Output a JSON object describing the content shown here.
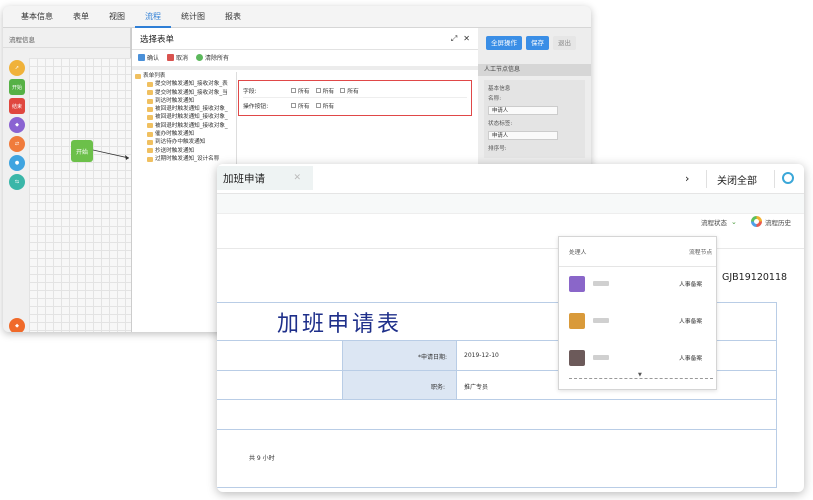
{
  "back": {
    "tabs": [
      "基本信息",
      "表单",
      "视图",
      "流程",
      "统计图",
      "报表"
    ],
    "active_tab": "流程",
    "left_panel_title": "流程信息",
    "palette": [
      {
        "name": "arrow-icon",
        "color": "#f0b23a",
        "label": ""
      },
      {
        "name": "start-icon",
        "color": "#56b146",
        "label": "开始"
      },
      {
        "name": "end-icon",
        "color": "#e0473e",
        "label": "结束"
      },
      {
        "name": "gateway-icon",
        "color": "#8a63d2",
        "label": ""
      },
      {
        "name": "task-icon",
        "color": "#f07b3c",
        "label": ""
      },
      {
        "name": "user-icon",
        "color": "#3fa4e0",
        "label": ""
      },
      {
        "name": "branch-icon",
        "color": "#3ab6a8",
        "label": ""
      },
      {
        "name": "eraser-icon",
        "color": "#f06a2a",
        "label": ""
      }
    ],
    "start_node_label": "开始",
    "dialog": {
      "title": "选择表单",
      "ctrl_expand": "⤢",
      "ctrl_close": "✕",
      "tools": [
        "确认",
        "取消",
        "清除所有"
      ],
      "tree_root": "表单列表",
      "tree_items": [
        "提交时触发通知_接收对象_表",
        "提交时触发通知_接收对象_当",
        "到达时触发通知",
        "被回退时触发通知_接收对象_",
        "被回退时触发通知_接收对象_",
        "被回退时触发通知_接收对象_",
        "催办时触发通知",
        "到达待办中触发通知",
        "抄送时触发通知",
        "过期时触发通知_设计名称"
      ],
      "field_rows": [
        {
          "label": "字段:",
          "options": [
            "所有",
            "所有",
            "所有"
          ]
        },
        {
          "label": "操作按钮:",
          "options": [
            "所有",
            "所有"
          ]
        }
      ]
    },
    "right_panel": {
      "buttons": [
        "全屏操作",
        "保存",
        "退出"
      ],
      "section_title": "人工节点信息",
      "box_title": "基本信息",
      "name_label": "名称:",
      "name_value": "申请人",
      "state_label": "状态标签:",
      "state_value": "申请人",
      "order_label": "排序号:"
    }
  },
  "front": {
    "tab_title": "加班申请",
    "tab_close": "✕",
    "nav_arrow": "›",
    "close_all": "关闭全部",
    "flow_status": "流程状态",
    "flow_history": "流程历史",
    "form_title": "加班申请表",
    "doc_no": "GJB19120118",
    "fields": [
      {
        "label": "*申请日期:",
        "value": "2019-12-10"
      },
      {
        "label": "职务:",
        "value": "推广专员"
      }
    ],
    "footer_text": "共  9  小时",
    "history": {
      "col_handler": "处理人",
      "col_node": "流程节点",
      "rows": [
        {
          "node": "人事备案",
          "avatar_color": "#8a66c9"
        },
        {
          "node": "人事备案",
          "avatar_color": "#d99a3a"
        },
        {
          "node": "人事备案",
          "avatar_color": "#6c5a5a"
        }
      ],
      "more_arrow": "▼"
    }
  }
}
